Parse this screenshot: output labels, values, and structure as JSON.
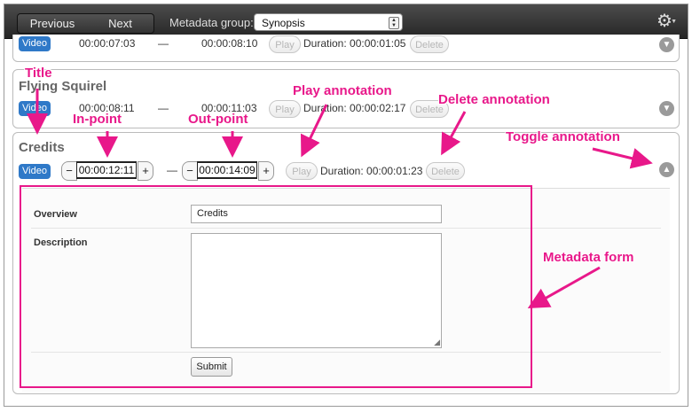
{
  "toolbar": {
    "previous_label": "Previous",
    "next_label": "Next",
    "metadata_group_label": "Metadata group:",
    "metadata_group_value": "Synopsis"
  },
  "annotations": [
    {
      "title": "",
      "media": "Video",
      "in_point": "00:00:07:03",
      "out_point": "00:00:08:10",
      "play_label": "Play",
      "duration": "Duration: 00:00:01:05",
      "delete_label": "Delete"
    },
    {
      "title": "Flying Squirel",
      "media": "Video",
      "in_point": "00:00:08:11",
      "out_point": "00:00:11:03",
      "play_label": "Play",
      "duration": "Duration: 00:00:02:17",
      "delete_label": "Delete"
    },
    {
      "title": "Credits",
      "media": "Video",
      "in_point": "00:00:12:11",
      "out_point": "00:00:14:09",
      "play_label": "Play",
      "duration": "Duration: 00:00:01:23",
      "delete_label": "Delete"
    }
  ],
  "dash": "—",
  "stepper": {
    "minus": "−",
    "plus": "+"
  },
  "form": {
    "overview_label": "Overview",
    "overview_value": "Credits",
    "description_label": "Description",
    "submit_label": "Submit"
  },
  "callouts": {
    "title": "Title",
    "in_point": "In-point",
    "out_point": "Out-point",
    "play_annotation": "Play annotation",
    "delete_annotation": "Delete annotation",
    "toggle_annotation": "Toggle annotation",
    "metadata_form": "Metadata form"
  },
  "colors": {
    "callout": "#e8188a",
    "video_badge": "#2f79c8",
    "toolbar": "#333333"
  },
  "icons": {
    "settings": "gear-icon",
    "toggle": "circle-arrow-icon"
  }
}
